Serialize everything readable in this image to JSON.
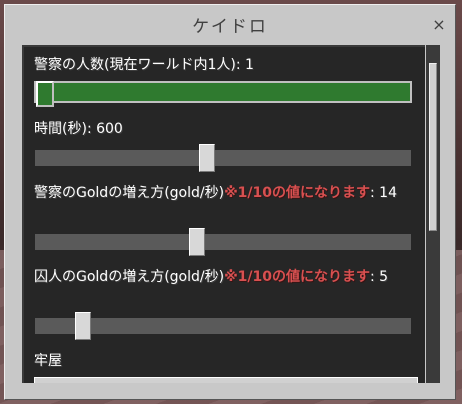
{
  "window": {
    "title": "ケイドロ",
    "close_glyph": "×"
  },
  "settings": [
    {
      "label": "警察の人数(現在ワールド内1人)",
      "value_text": ": 1",
      "note": "",
      "slider_fraction": 0.0
    },
    {
      "label": "時間(秒)",
      "value_text": ": 600",
      "note": "",
      "slider_fraction": 0.5
    },
    {
      "label": "警察のGoldの増え方(gold/秒)",
      "note": "※1/10の値になります",
      "value_text": ": 14",
      "slider_fraction": 0.45
    },
    {
      "label": "囚人のGoldの増え方(gold/秒)",
      "note": "※1/10の値になります",
      "value_text": ": 5",
      "slider_fraction": 0.13
    },
    {
      "label": "牢屋",
      "value_text": "",
      "note": ""
    }
  ],
  "colors": {
    "accent_green": "#2f7a2f",
    "note_red": "#d85050"
  }
}
